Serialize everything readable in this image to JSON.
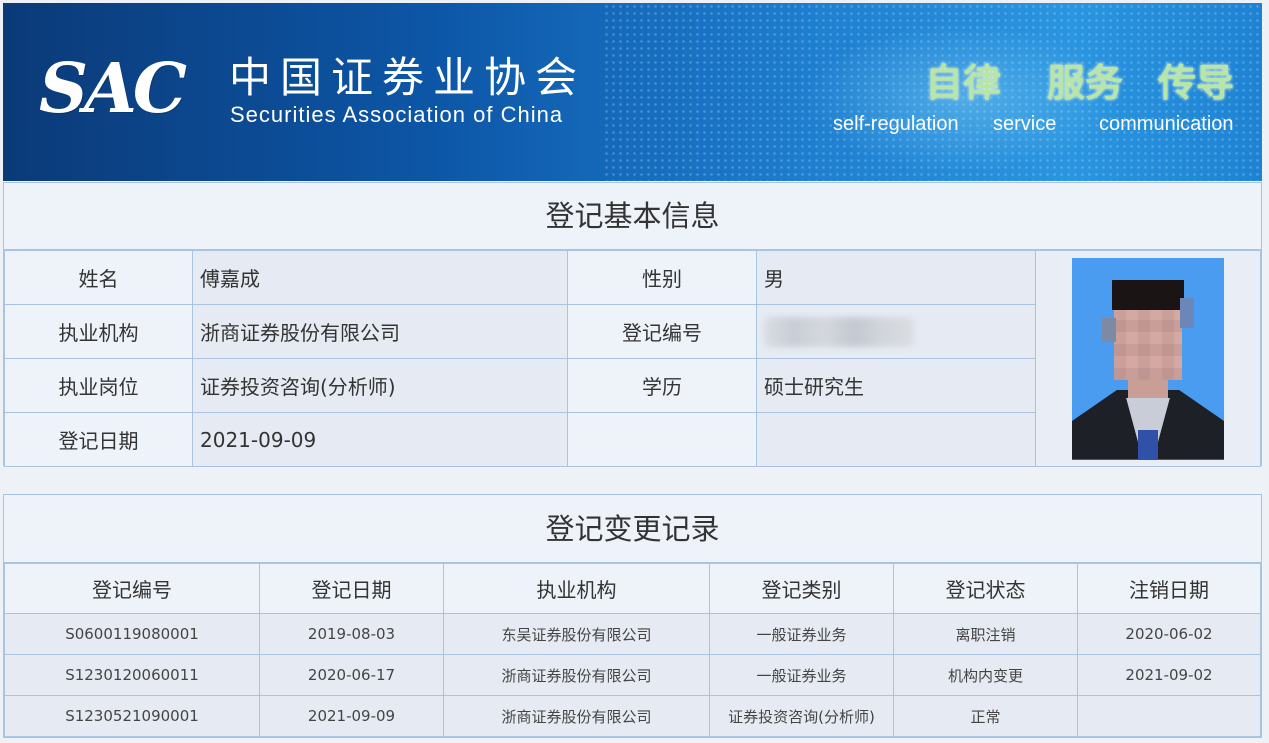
{
  "header": {
    "logo_text": "SAC",
    "org_name_cn": "中国证券业协会",
    "org_name_en": "Securities Association of China",
    "slogans": [
      {
        "cn": "自律",
        "en": "self-regulation"
      },
      {
        "cn": "服务",
        "en": "service"
      },
      {
        "cn": "传导",
        "en": "communication"
      }
    ]
  },
  "basic_info": {
    "title": "登记基本信息",
    "name_label": "姓名",
    "name_value": "傅嘉成",
    "gender_label": "性别",
    "gender_value": "男",
    "org_label": "执业机构",
    "org_value": "浙商证券股份有限公司",
    "reg_no_label": "登记编号",
    "reg_no_value": "",
    "position_label": "执业岗位",
    "position_value": "证券投资咨询(分析师)",
    "education_label": "学历",
    "education_value": "硕士研究生",
    "reg_date_label": "登记日期",
    "reg_date_value": "2021-09-09",
    "photo_icon": "person-photo"
  },
  "change_records": {
    "title": "登记变更记录",
    "columns": [
      "登记编号",
      "登记日期",
      "执业机构",
      "登记类别",
      "登记状态",
      "注销日期"
    ],
    "rows": [
      [
        "S0600119080001",
        "2019-08-03",
        "东吴证券股份有限公司",
        "一般证券业务",
        "离职注销",
        "2020-06-02"
      ],
      [
        "S1230120060011",
        "2020-06-17",
        "浙商证券股份有限公司",
        "一般证券业务",
        "机构内变更",
        "2021-09-02"
      ],
      [
        "S1230521090001",
        "2021-09-09",
        "浙商证券股份有限公司",
        "证券投资咨询(分析师)",
        "正常",
        ""
      ]
    ]
  }
}
